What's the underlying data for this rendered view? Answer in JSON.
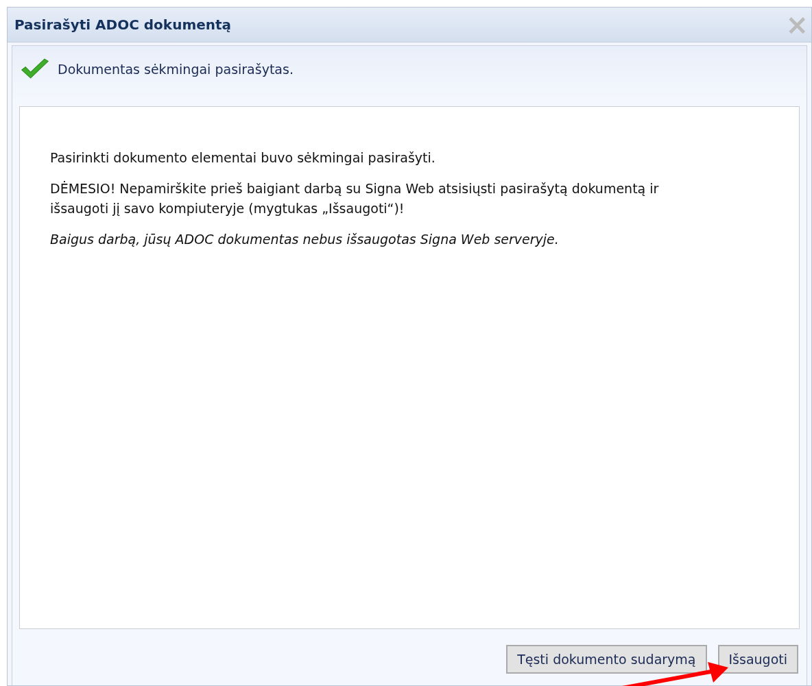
{
  "dialog": {
    "title": "Pasirašyti ADOC dokumentą",
    "close": "×"
  },
  "status": {
    "kind": "success",
    "message": "Dokumentas sėkmingai pasirašytas."
  },
  "body": [
    {
      "kind": "normal",
      "text": "Pasirinkti dokumento elementai buvo sėkmingai pasirašyti."
    },
    {
      "kind": "normal",
      "text": "DĖMESIO! Nepamirškite prieš baigiant darbą su Signa Web atsisiųsti pasirašytą dokumentą ir išsaugoti jį savo kompiuteryje (mygtukas „Išsaugoti“)!"
    },
    {
      "kind": "italic",
      "text": "Baigus darbą, jūsų ADOC dokumentas nebus išsaugotas Signa Web serveryje."
    }
  ],
  "buttons": [
    "Tęsti dokumento sudarymą",
    "Išsaugoti"
  ]
}
